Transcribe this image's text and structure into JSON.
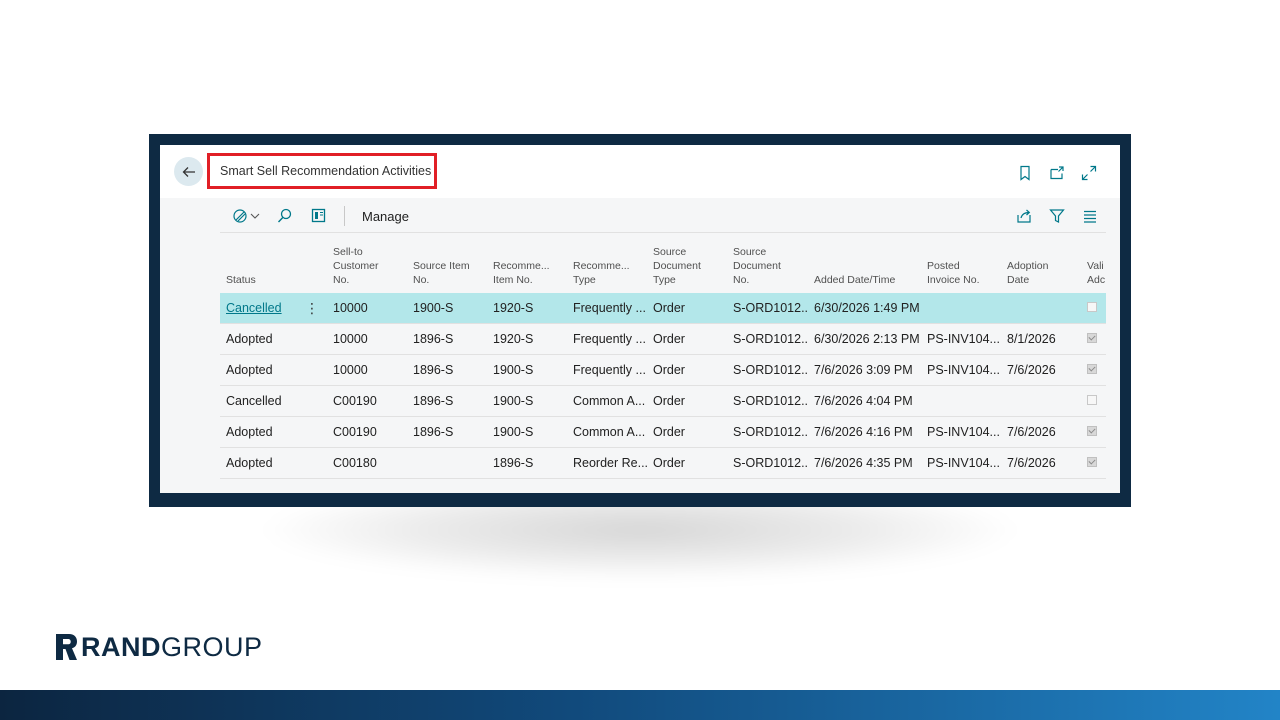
{
  "page": {
    "title": "Smart Sell Recommendation Activities"
  },
  "toolbar": {
    "manage_label": "Manage"
  },
  "icons": {
    "back": "arrow-left-icon",
    "bookmark": "bookmark-icon",
    "open_new": "open-in-new-window-icon",
    "expand": "expand-icon",
    "analyze": "analysis-mode-icon",
    "search": "search-icon",
    "layout": "layout-icon",
    "share": "share-icon",
    "filter": "filter-icon",
    "list": "list-view-icon"
  },
  "table": {
    "headers": [
      [
        "Status"
      ],
      [
        "Sell-to",
        "Customer",
        "No."
      ],
      [
        "Source Item",
        "No."
      ],
      [
        "Recomme...",
        "Item No."
      ],
      [
        "Recomme...",
        "Type"
      ],
      [
        "Source",
        "Document",
        "Type"
      ],
      [
        "Source",
        "Document",
        "No."
      ],
      [
        "Added Date/Time"
      ],
      [
        "Posted",
        "Invoice No."
      ],
      [
        "Adoption",
        "Date"
      ],
      [
        "Vali",
        "Adc"
      ]
    ],
    "rows": [
      {
        "status": "Cancelled",
        "customer": "10000",
        "source_item": "1900-S",
        "rec_item": "1920-S",
        "rec_type": "Frequently ...",
        "doc_type": "Order",
        "doc_no": "S-ORD1012...",
        "added": "6/30/2026 1:49 PM",
        "invoice": "",
        "adoption": "",
        "valid": false,
        "selected": true
      },
      {
        "status": "Adopted",
        "customer": "10000",
        "source_item": "1896-S",
        "rec_item": "1920-S",
        "rec_type": "Frequently ...",
        "doc_type": "Order",
        "doc_no": "S-ORD1012...",
        "added": "6/30/2026 2:13 PM",
        "invoice": "PS-INV104...",
        "adoption": "8/1/2026",
        "valid": true,
        "selected": false
      },
      {
        "status": "Adopted",
        "customer": "10000",
        "source_item": "1896-S",
        "rec_item": "1900-S",
        "rec_type": "Frequently ...",
        "doc_type": "Order",
        "doc_no": "S-ORD1012...",
        "added": "7/6/2026 3:09 PM",
        "invoice": "PS-INV104...",
        "adoption": "7/6/2026",
        "valid": true,
        "selected": false
      },
      {
        "status": "Cancelled",
        "customer": "C00190",
        "source_item": "1896-S",
        "rec_item": "1900-S",
        "rec_type": "Common A...",
        "doc_type": "Order",
        "doc_no": "S-ORD1012...",
        "added": "7/6/2026 4:04 PM",
        "invoice": "",
        "adoption": "",
        "valid": false,
        "selected": false
      },
      {
        "status": "Adopted",
        "customer": "C00190",
        "source_item": "1896-S",
        "rec_item": "1900-S",
        "rec_type": "Common A...",
        "doc_type": "Order",
        "doc_no": "S-ORD1012...",
        "added": "7/6/2026 4:16 PM",
        "invoice": "PS-INV104...",
        "adoption": "7/6/2026",
        "valid": true,
        "selected": false
      },
      {
        "status": "Adopted",
        "customer": "C00180",
        "source_item": "",
        "rec_item": "1896-S",
        "rec_type": "Reorder Re...",
        "doc_type": "Order",
        "doc_no": "S-ORD1012...",
        "added": "7/6/2026 4:35 PM",
        "invoice": "PS-INV104...",
        "adoption": "7/6/2026",
        "valid": true,
        "selected": false
      }
    ]
  },
  "branding": {
    "logo_text_bold": "RAND",
    "logo_text_light": "GROUP"
  },
  "colors": {
    "frame": "#0e2a43",
    "selected_row": "#b3e7ea",
    "link": "#00788a",
    "highlight_box": "#e11f26",
    "accent": "#00788a"
  }
}
